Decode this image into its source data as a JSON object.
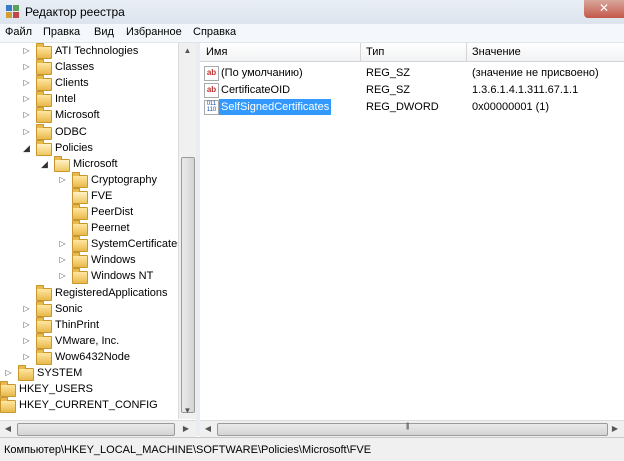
{
  "window": {
    "title": "Редактор реестра"
  },
  "menu": [
    "Файл",
    "Правка",
    "Вид",
    "Избранное",
    "Справка"
  ],
  "tree": [
    {
      "label": "ATI Technologies",
      "expander": "collapsed",
      "level": 2
    },
    {
      "label": "Classes",
      "expander": "collapsed",
      "level": 2
    },
    {
      "label": "Clients",
      "expander": "collapsed",
      "level": 2
    },
    {
      "label": "Intel",
      "expander": "collapsed",
      "level": 2
    },
    {
      "label": "Microsoft",
      "expander": "collapsed",
      "level": 2
    },
    {
      "label": "ODBC",
      "expander": "collapsed",
      "level": 2
    },
    {
      "label": "Policies",
      "expander": "expanded",
      "level": 2
    },
    {
      "label": "Microsoft",
      "expander": "expanded",
      "level": 3
    },
    {
      "label": "Cryptography",
      "expander": "collapsed",
      "level": 4
    },
    {
      "label": "FVE",
      "expander": "none",
      "level": 4,
      "selected": true
    },
    {
      "label": "PeerDist",
      "expander": "none",
      "level": 4
    },
    {
      "label": "Peernet",
      "expander": "none",
      "level": 4
    },
    {
      "label": "SystemCertificates",
      "expander": "collapsed",
      "level": 4
    },
    {
      "label": "Windows",
      "expander": "collapsed",
      "level": 4
    },
    {
      "label": "Windows NT",
      "expander": "collapsed",
      "level": 4
    },
    {
      "label": "RegisteredApplications",
      "expander": "none",
      "level": 2
    },
    {
      "label": "Sonic",
      "expander": "collapsed",
      "level": 2
    },
    {
      "label": "ThinPrint",
      "expander": "collapsed",
      "level": 2
    },
    {
      "label": "VMware, Inc.",
      "expander": "collapsed",
      "level": 2
    },
    {
      "label": "Wow6432Node",
      "expander": "collapsed",
      "level": 2
    },
    {
      "label": "SYSTEM",
      "expander": "collapsed",
      "level": 1
    },
    {
      "label": "HKEY_USERS",
      "expander": "collapsed",
      "level": 0
    },
    {
      "label": "HKEY_CURRENT_CONFIG",
      "expander": "collapsed",
      "level": 0
    }
  ],
  "list": {
    "columns": [
      "Имя",
      "Тип",
      "Значение"
    ],
    "rows": [
      {
        "name": "(По умолчанию)",
        "type": "REG_SZ",
        "value": "(значение не присвоено)",
        "icon": "string-value-icon",
        "icon_text": "ab"
      },
      {
        "name": "CertificateOID",
        "type": "REG_SZ",
        "value": "1.3.6.1.4.1.311.67.1.1",
        "icon": "string-value-icon",
        "icon_text": "ab"
      },
      {
        "name": "SelfSignedCertificates",
        "type": "REG_DWORD",
        "value": "0x00000001 (1)",
        "icon": "binary-value-icon",
        "icon_text": "011\n110",
        "selected": true
      }
    ]
  },
  "status": {
    "path": "Компьютер\\HKEY_LOCAL_MACHINE\\SOFTWARE\\Policies\\Microsoft\\FVE"
  },
  "colors": {
    "selection": "#3399ff",
    "folder": "#e8b94d"
  }
}
